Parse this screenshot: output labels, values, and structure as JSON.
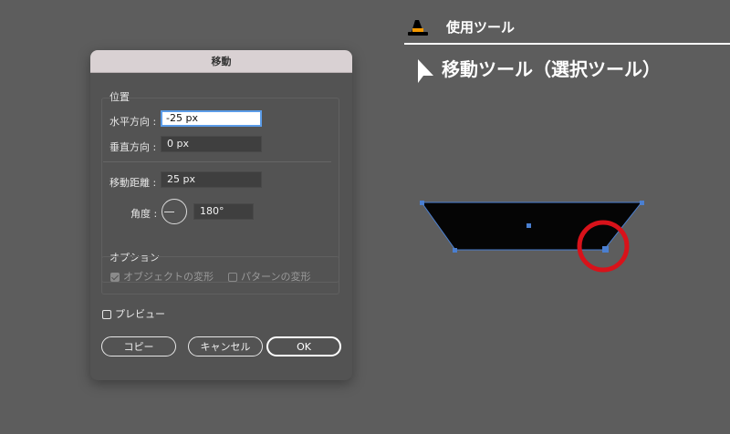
{
  "dialog": {
    "title": "移動",
    "position": {
      "legend": "位置",
      "horizontal_label": "水平方向 :",
      "horizontal_value": "-25 px",
      "vertical_label": "垂直方向 :",
      "vertical_value": "0 px",
      "distance_label": "移動距離 :",
      "distance_value": "25 px",
      "angle_label": "角度 :",
      "angle_value": "180°"
    },
    "options": {
      "legend": "オプション",
      "transform_objects": "オブジェクトの変形",
      "transform_objects_checked": true,
      "transform_patterns": "パターンの変形",
      "transform_patterns_checked": false
    },
    "preview": {
      "label": "プレビュー",
      "checked": false
    },
    "buttons": {
      "copy": "コピー",
      "cancel": "キャンセル",
      "ok": "OK"
    }
  },
  "annotation": {
    "tool_used": "使用ツール",
    "tool_name": "移動ツール（選択ツール）"
  },
  "colors": {
    "background": "#5d5d5d",
    "dialog_bg": "#535353",
    "titlebar": "#d9d1d3",
    "focus_ring": "#5b9ce8",
    "selection_blue": "#4a7fd1",
    "highlight_circle": "#d8121a",
    "hat_orange": "#f39800"
  },
  "icons": [
    "witch-hat-icon",
    "arrow-cursor-icon",
    "angle-dial-icon"
  ]
}
